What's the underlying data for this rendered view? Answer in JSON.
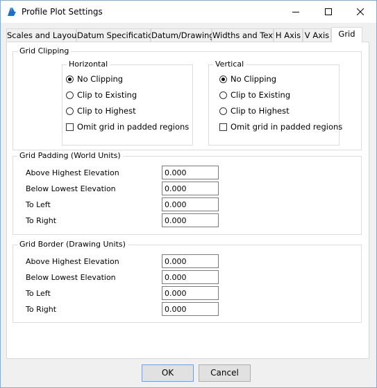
{
  "window": {
    "title": "Profile Plot Settings",
    "accent": "#1e6fc8"
  },
  "tabs": [
    {
      "label": "Scales and Layout"
    },
    {
      "label": "Datum Specification"
    },
    {
      "label": "Datum/Drawing"
    },
    {
      "label": "Widths and Text"
    },
    {
      "label": "H Axis"
    },
    {
      "label": "V Axis"
    },
    {
      "label": "Grid",
      "active": true
    }
  ],
  "grid_clipping": {
    "legend": "Grid Clipping",
    "horizontal": {
      "legend": "Horizontal",
      "options": [
        "No Clipping",
        "Clip to Existing",
        "Clip to Highest"
      ],
      "selected": "No Clipping",
      "omit_label": "Omit grid in padded regions",
      "omit_checked": false
    },
    "vertical": {
      "legend": "Vertical",
      "options": [
        "No Clipping",
        "Clip to Existing",
        "Clip to Highest"
      ],
      "selected": "No Clipping",
      "omit_label": "Omit grid in padded regions",
      "omit_checked": false
    }
  },
  "grid_padding": {
    "legend": "Grid Padding (World Units)",
    "fields": [
      {
        "label": "Above Highest Elevation",
        "value": "0.000"
      },
      {
        "label": "Below Lowest Elevation",
        "value": "0.000"
      },
      {
        "label": "To Left",
        "value": "0.000"
      },
      {
        "label": "To Right",
        "value": "0.000"
      }
    ]
  },
  "grid_border": {
    "legend": "Grid Border (Drawing Units)",
    "fields": [
      {
        "label": "Above Highest Elevation",
        "value": "0.000"
      },
      {
        "label": "Below Lowest Elevation",
        "value": "0.000"
      },
      {
        "label": "To Left",
        "value": "0.000"
      },
      {
        "label": "To Right",
        "value": "0.000"
      }
    ]
  },
  "buttons": {
    "ok": "OK",
    "cancel": "Cancel"
  }
}
